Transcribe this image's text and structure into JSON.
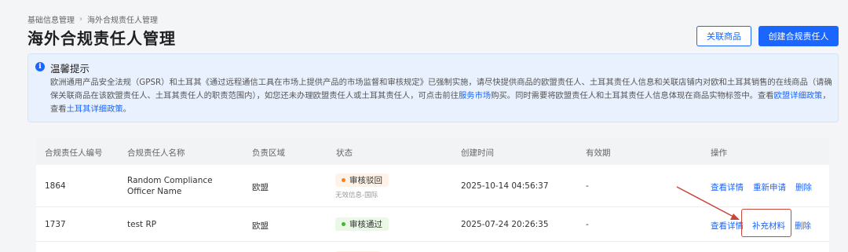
{
  "breadcrumb": {
    "items": [
      "基础信息管理",
      "海外合规责任人管理"
    ],
    "separator": "›"
  },
  "page_title": "海外合规责任人管理",
  "header_buttons": {
    "link_products": "关联商品",
    "create_rp": "创建合规责任人"
  },
  "notice": {
    "icon": "info-icon",
    "title": "温馨提示",
    "text_1": "欧洲通用产品安全法规（GPSR）和土耳其《通过远程通信工具在市场上提供产品的市场监督和审核规定》已强制实施，请尽快提供商品的欧盟责任人、土耳其责任人信息和关联店铺内对欧和土耳其销售的在线商品（请确保关联商品在该欧盟责任人、土耳其责任人的职责范围内），如您还未办理欧盟责任人或土耳其责任人，可点击前往",
    "link_service_market": "服务市场",
    "text_2": "购买。同时需要将欧盟责任人和土耳其责任人信息体现在商品实物标签中。查看",
    "link_eu_policy": "欧盟详细政策",
    "text_3": "，查看",
    "link_tr_policy": "土耳其详细政策",
    "text_4": "。"
  },
  "table": {
    "headers": [
      "合规责任人编号",
      "合规责任人名称",
      "负责区域",
      "状态",
      "创建时间",
      "有效期",
      "操作"
    ],
    "rows": [
      {
        "id": "1864",
        "name": "Random Compliance Officer Name",
        "region": "欧盟",
        "status": "审核驳回",
        "status_note": "无效信息-国际",
        "created": "2025-10-14 04:56:37",
        "validity": "-",
        "actions": [
          "查看详情",
          "重新申请",
          "删除"
        ]
      },
      {
        "id": "1737",
        "name": "test RP",
        "region": "欧盟",
        "status": "审核通过",
        "created": "2025-07-24 20:26:35",
        "validity": "-",
        "actions": [
          "查看详情",
          "补充材料",
          "删除"
        ]
      }
    ]
  },
  "colors": {
    "primary": "#1a66ff",
    "reject_dot": "#ff7d1a",
    "pass_dot": "#3cba2e",
    "annotation": "#c9463d"
  }
}
